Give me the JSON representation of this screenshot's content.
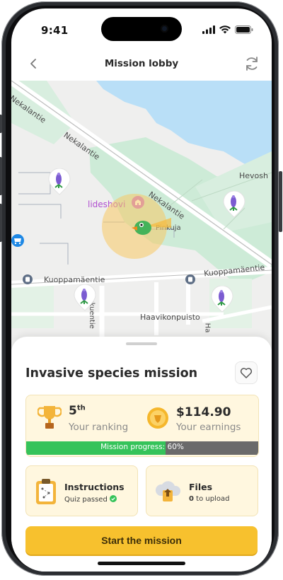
{
  "status_bar": {
    "time": "9:41"
  },
  "nav": {
    "title": "Mission lobby"
  },
  "map": {
    "street_labels": [
      "Nekalantie",
      "Nekalantie",
      "Nekalantie",
      "Kuoppamäentie",
      "Kuoppamäentie",
      "Koskuentie",
      "Haavikonpuisto",
      "Hevosh",
      "Pinkuja",
      "Ha"
    ],
    "poi_label": "lideshovi"
  },
  "mission": {
    "title": "Invasive species mission",
    "ranking_value": "5",
    "ranking_suffix": "th",
    "ranking_label": "Your ranking",
    "earnings_value": "$114.90",
    "earnings_label": "Your earnings",
    "progress_text": "Mission progress: 60%",
    "progress_value": 0.6
  },
  "cards": {
    "instructions_title": "Instructions",
    "instructions_sub": "Quiz passed",
    "files_title": "Files",
    "files_count": "0",
    "files_sub": "to upload"
  },
  "cta": {
    "label": "Start the mission"
  },
  "colors": {
    "accent": "#f7c12e",
    "progress": "#35c35a",
    "card_bg": "#fff7df",
    "water": "#b9dff7",
    "park": "#cdebd7"
  },
  "icons": [
    "back-icon",
    "refresh-icon",
    "heart-icon",
    "trophy-icon",
    "coin-icon",
    "clipboard-icon",
    "cloud-upload-icon",
    "check-icon",
    "lupine-icon",
    "shop-icon",
    "bus-stop-icon",
    "duck-avatar-icon"
  ]
}
